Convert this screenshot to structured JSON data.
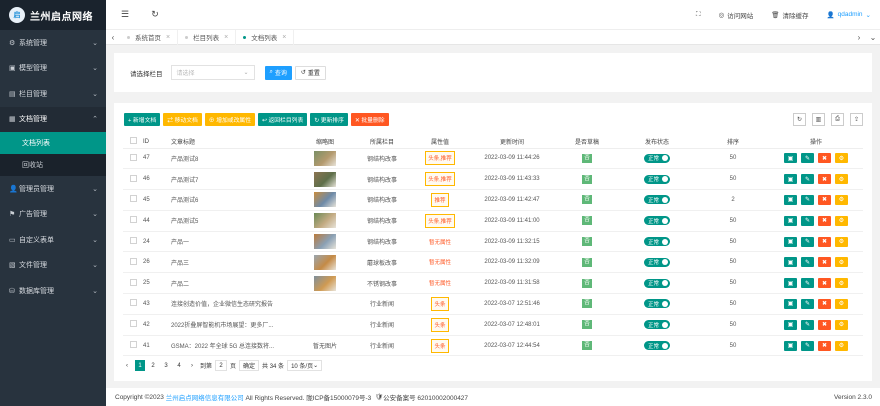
{
  "logo": {
    "mark": "启",
    "text": "兰州启点网络"
  },
  "sidebar": {
    "items": [
      {
        "icon": "⚙",
        "label": "系统管理",
        "arrow": "⌄"
      },
      {
        "icon": "▣",
        "label": "模型管理",
        "arrow": "⌄"
      },
      {
        "icon": "▤",
        "label": "栏目管理",
        "arrow": "⌄"
      },
      {
        "icon": "▦",
        "label": "文档管理",
        "arrow": "⌃"
      }
    ],
    "sub": [
      {
        "label": "文档列表"
      },
      {
        "label": "回收站"
      }
    ],
    "items2": [
      {
        "icon": "👤",
        "label": "管理员管理",
        "arrow": "⌄"
      },
      {
        "icon": "⚑",
        "label": "广告管理",
        "arrow": "⌄"
      },
      {
        "icon": "▭",
        "label": "自定义表单",
        "arrow": "⌄"
      },
      {
        "icon": "▧",
        "label": "文件管理",
        "arrow": "⌄"
      },
      {
        "icon": "⛁",
        "label": "数据库管理",
        "arrow": "⌄"
      }
    ]
  },
  "header": {
    "visit_site": "访问网站",
    "clear_cache": "清除缓存",
    "user": "qdadmin"
  },
  "tabs": [
    {
      "label": "系统首页"
    },
    {
      "label": "栏目列表"
    },
    {
      "label": "文档列表"
    }
  ],
  "filter": {
    "label": "请选择栏目",
    "placeholder": "请选择",
    "search": "查询",
    "reset": "重置"
  },
  "toolbar": {
    "buttons": [
      {
        "label": "+ 新增文档",
        "color": "#009688"
      },
      {
        "label": "⇄ 移动文档",
        "color": "#ffb800"
      },
      {
        "label": "⊕ 增加或改属性",
        "color": "#ffb800"
      },
      {
        "label": "↩ 返回栏目列表",
        "color": "#009688"
      },
      {
        "label": "↻ 更新排序",
        "color": "#009688"
      },
      {
        "label": "✕ 批量删除",
        "color": "#ff5722"
      }
    ]
  },
  "table": {
    "headers": [
      "ID",
      "文章标题",
      "缩略图",
      "所属栏目",
      "属性值",
      "更新时间",
      "是否草稿",
      "发布状态",
      "排序",
      "操作"
    ],
    "rows": [
      {
        "id": "47",
        "title": "产品测试8",
        "thumb": true,
        "cat": "钢结构改事",
        "attr": "头条,推荐",
        "time": "2022-03-09 11:44:26",
        "draft": "否",
        "status": "正常",
        "sort": "50"
      },
      {
        "id": "46",
        "title": "产品测试7",
        "thumb": true,
        "cat": "钢结构改事",
        "attr": "头条,推荐",
        "time": "2022-03-09 11:43:33",
        "draft": "否",
        "status": "正常",
        "sort": "50"
      },
      {
        "id": "45",
        "title": "产品测试6",
        "thumb": true,
        "cat": "钢结构改事",
        "attr": "推荐",
        "time": "2022-03-09 11:42:47",
        "draft": "否",
        "status": "正常",
        "sort": "2"
      },
      {
        "id": "44",
        "title": "产品测试5",
        "thumb": true,
        "cat": "钢结构改事",
        "attr": "头条,推荐",
        "time": "2022-03-09 11:41:00",
        "draft": "否",
        "status": "正常",
        "sort": "50"
      },
      {
        "id": "24",
        "title": "产品一",
        "thumb": true,
        "cat": "钢结构改事",
        "attr": "暂无属性",
        "attrRed": true,
        "time": "2022-03-09 11:32:15",
        "draft": "否",
        "status": "正常",
        "sort": "50"
      },
      {
        "id": "26",
        "title": "产品三",
        "thumb": true,
        "cat": "蘑球板改事",
        "attr": "暂无属性",
        "attrRed": true,
        "time": "2022-03-09 11:32:09",
        "draft": "否",
        "status": "正常",
        "sort": "50"
      },
      {
        "id": "25",
        "title": "产品二",
        "thumb": true,
        "cat": "不锈钢改事",
        "attr": "暂无属性",
        "attrRed": true,
        "time": "2022-03-09 11:31:58",
        "draft": "否",
        "status": "正常",
        "sort": "50"
      },
      {
        "id": "43",
        "title": "连接创造价值，企业微信生态研究报告",
        "thumb": false,
        "cat": "行业新闻",
        "attr": "头条",
        "time": "2022-03-07 12:51:46",
        "draft": "否",
        "status": "正常",
        "sort": "50"
      },
      {
        "id": "42",
        "title": "2022折叠屏智能机市场展望：更多厂...",
        "thumb": false,
        "cat": "行业新闻",
        "attr": "头条",
        "time": "2022-03-07 12:48:01",
        "draft": "否",
        "status": "正常",
        "sort": "50"
      },
      {
        "id": "41",
        "title": "GSMA：2022 年全球 5G 总连接数将...",
        "thumb": false,
        "thumbText": "暂无图片",
        "cat": "行业新闻",
        "attr": "头条",
        "time": "2022-03-07 12:44:54",
        "draft": "否",
        "status": "正常",
        "sort": "50"
      }
    ]
  },
  "pager": {
    "pages": [
      "1",
      "2",
      "3",
      "4"
    ],
    "goto": "到第",
    "value": "2",
    "page_unit": "页",
    "confirm": "确定",
    "total": "共 34 条",
    "per_page": "10 条/页"
  },
  "footer": {
    "copyright": "Copyright ©2023",
    "company": "兰州启点网络信息有限公司",
    "rights": "All Rights Reserved. 陇ICP备15000079号-3",
    "police": "公安备案号 62010002000427",
    "version": "Version 2.3.0"
  }
}
